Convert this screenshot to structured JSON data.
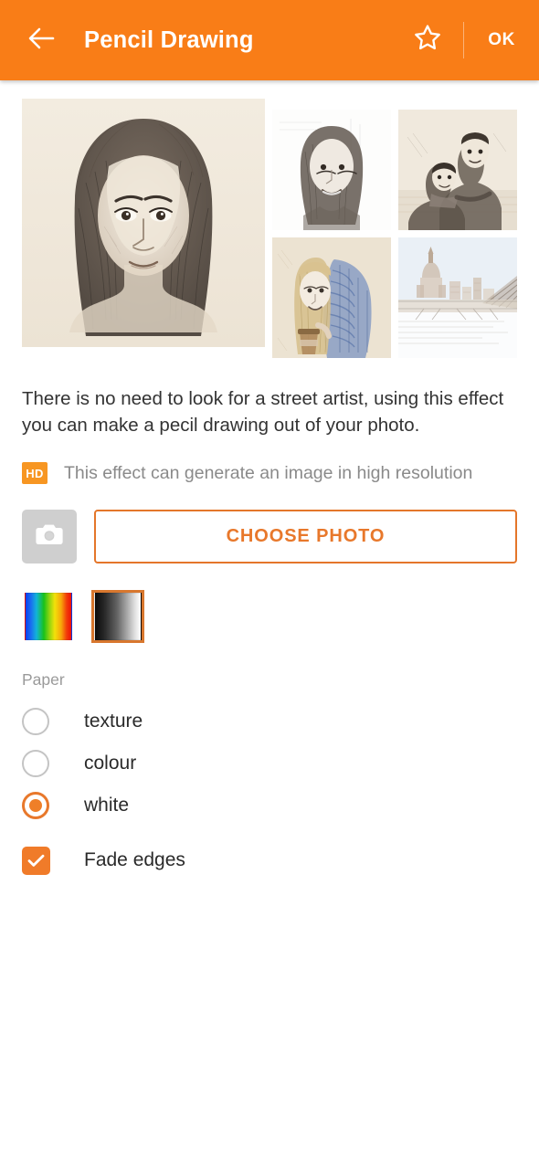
{
  "appbar": {
    "back_icon": "arrow-left-icon",
    "title": "Pencil Drawing",
    "favorite_icon": "star-outline-icon",
    "ok_label": "OK",
    "background_color": "#f97d17",
    "text_color": "#ffffff"
  },
  "gallery": {
    "hero": {
      "alt": "pencil sketch portrait of a woman with long dark hair",
      "subject": "woman-portrait"
    },
    "thumbnails": [
      {
        "alt": "pencil sketch of a smiling young woman with long hair",
        "subject": "smiling-woman"
      },
      {
        "alt": "pencil sketch of a couple embracing outdoors",
        "subject": "couple-embracing"
      },
      {
        "alt": "pencil sketch of a blonde woman in a blue knitted scarf holding a coffee cup",
        "subject": "woman-with-coffee"
      },
      {
        "alt": "pencil sketch of a city skyline with a cathedral dome and bridge",
        "subject": "city-skyline"
      }
    ]
  },
  "description": {
    "text": "There is no need to look for a street artist, using this effect you can make a pecil drawing out of your photo."
  },
  "hd_notice": {
    "badge_label": "HD",
    "badge_color": "#f79622",
    "text": "This effect can generate an image in high resolution",
    "text_color": "#8a8a8a"
  },
  "actions": {
    "camera_icon": "camera-icon",
    "choose_photo_label": "CHOOSE PHOTO",
    "accent_color": "#e8782b"
  },
  "swatches": [
    {
      "name": "rainbow-gradient",
      "selected": false
    },
    {
      "name": "grayscale-gradient",
      "selected": true
    }
  ],
  "paper": {
    "label": "Paper",
    "options": [
      {
        "label": "texture",
        "selected": false
      },
      {
        "label": "colour",
        "selected": false
      },
      {
        "label": "white",
        "selected": true
      }
    ]
  },
  "fade_edges": {
    "label": "Fade edges",
    "checked": true,
    "check_icon": "checkmark-icon"
  }
}
